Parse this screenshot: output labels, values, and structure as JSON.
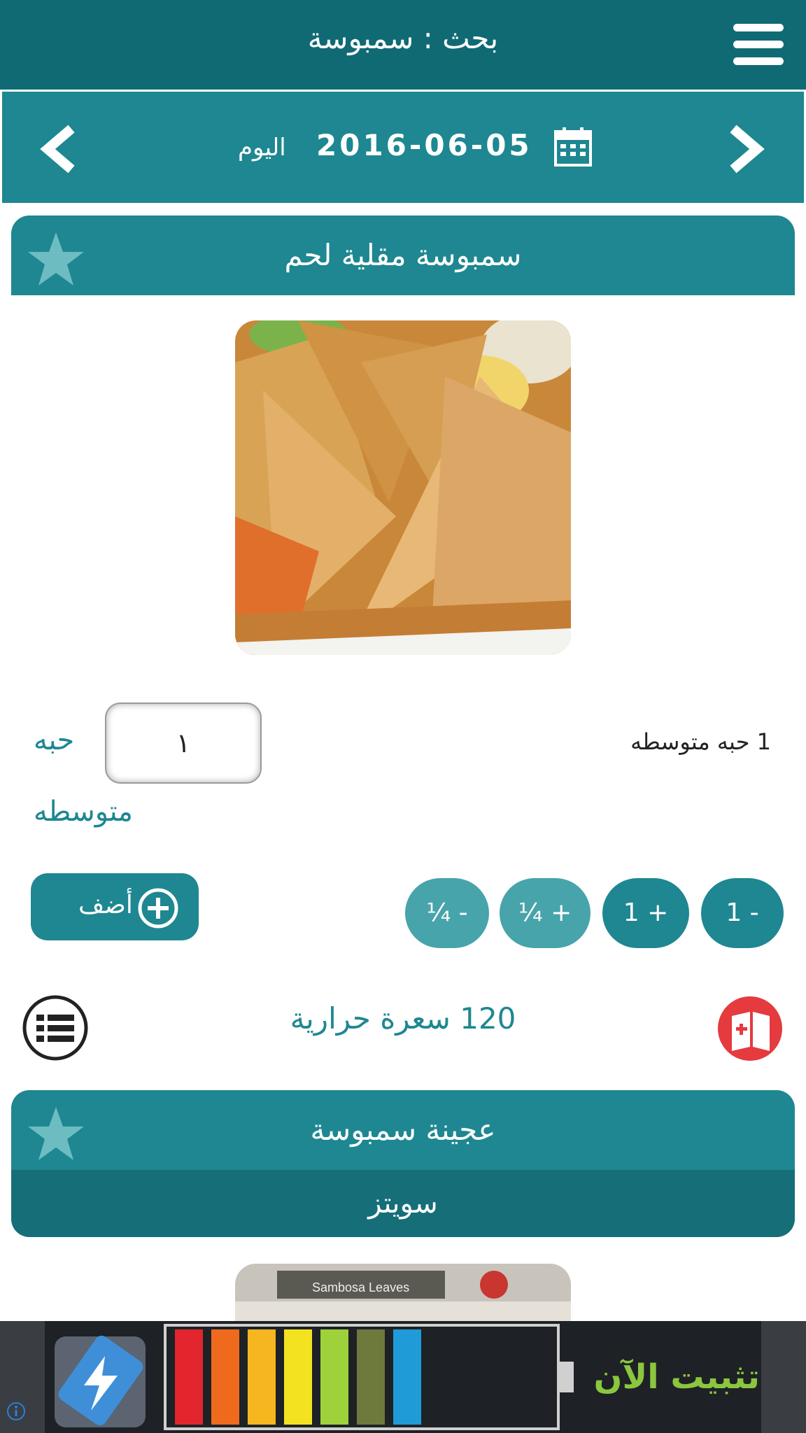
{
  "header": {
    "title": "بحث : سمبوسة"
  },
  "date_bar": {
    "date": "2016-06-05",
    "today_label": "اليوم"
  },
  "food_item": {
    "title": "سمبوسة مقلية لحم",
    "portion_description": "1 حبه متوسطه",
    "quantity_value": "١",
    "unit_label_line1": "حبه",
    "unit_label_line2": "متوسطه",
    "add_label": "أضف",
    "quantity_buttons": [
      "¼ -",
      "¼ +",
      "1 +",
      "1 -"
    ],
    "calories": "120 سعرة حرارية"
  },
  "food_item_2": {
    "title": "عجينة سمبوسة",
    "brand": "سويتز",
    "package_text": "Sambosa Leaves"
  },
  "ad": {
    "cta": "تثبيت الآن"
  },
  "colors": {
    "header": "#106a74",
    "accent": "#1e8791",
    "light_accent": "#47a4ab",
    "danger": "#e53a3e"
  },
  "icons": [
    "menu-icon",
    "calendar-icon",
    "chevron-left-icon",
    "chevron-right-icon",
    "star-icon",
    "plus-circle-icon",
    "list-icon",
    "diary-add-icon",
    "info-icon",
    "battery-app-icon"
  ]
}
